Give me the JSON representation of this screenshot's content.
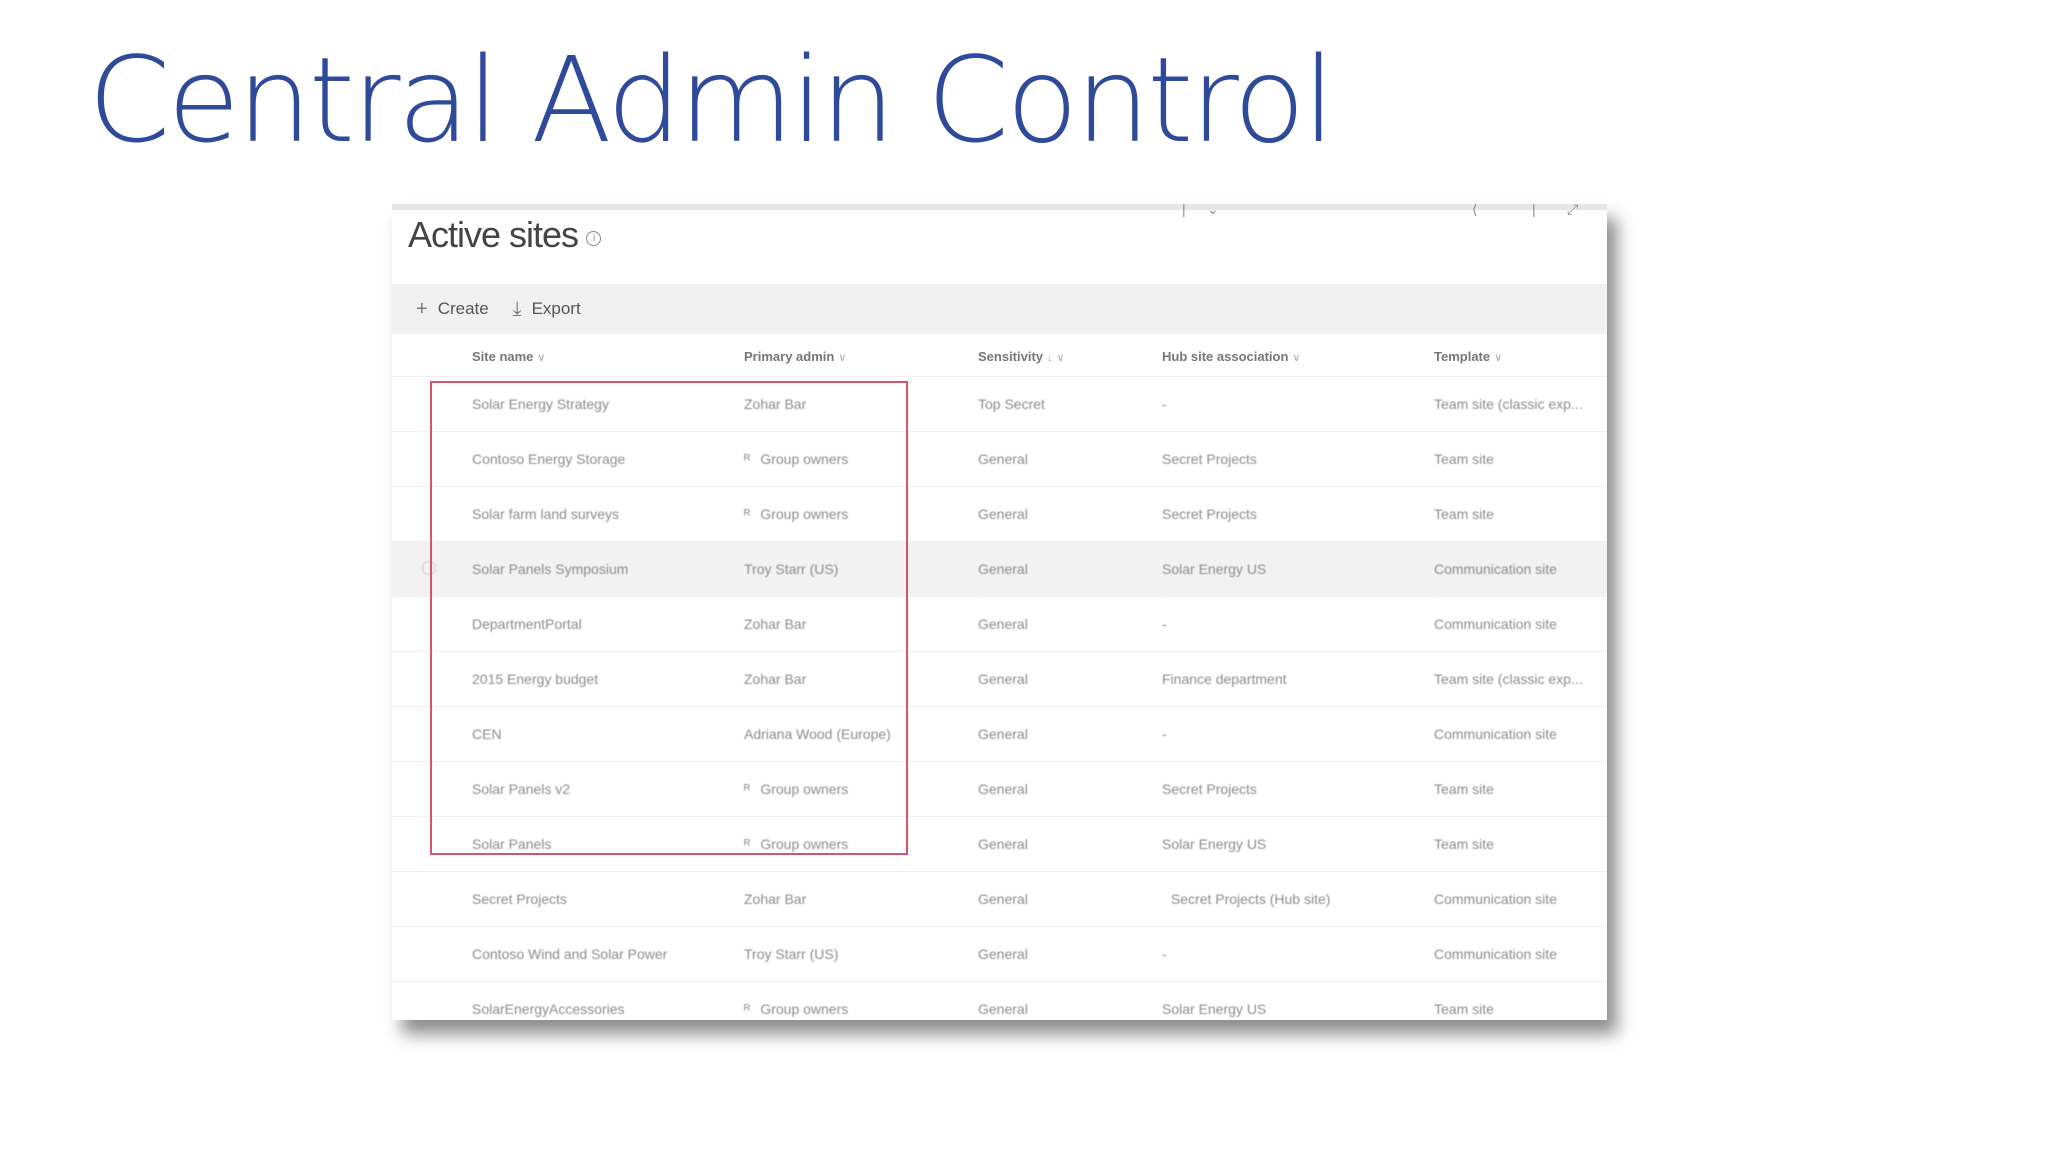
{
  "slide": {
    "title": "Central Admin Control"
  },
  "panel": {
    "title": "Active sites"
  },
  "toolbar": {
    "create_label": "Create",
    "export_label": "Export"
  },
  "table": {
    "columns": [
      {
        "label": "Site name"
      },
      {
        "label": "Primary admin"
      },
      {
        "label": "Sensitivity"
      },
      {
        "label": "Hub site association"
      },
      {
        "label": "Template"
      }
    ],
    "rows": [
      {
        "name": "Solar Energy Strategy",
        "admin": "Zohar Bar",
        "admin_is_group": false,
        "sensitivity": "Top Secret",
        "hub": "-",
        "template": "Team site (classic exp..."
      },
      {
        "name": "Contoso Energy Storage",
        "admin": "Group owners",
        "admin_is_group": true,
        "sensitivity": "General",
        "hub": "Secret Projects",
        "template": "Team site"
      },
      {
        "name": "Solar farm land surveys",
        "admin": "Group owners",
        "admin_is_group": true,
        "sensitivity": "General",
        "hub": "Secret Projects",
        "template": "Team site"
      },
      {
        "name": "Solar Panels Symposium",
        "admin": "Troy Starr (US)",
        "admin_is_group": false,
        "sensitivity": "General",
        "hub": "Solar Energy US",
        "template": "Communication site"
      },
      {
        "name": "DepartmentPortal",
        "admin": "Zohar Bar",
        "admin_is_group": false,
        "sensitivity": "General",
        "hub": "-",
        "template": "Communication site"
      },
      {
        "name": "2015 Energy budget",
        "admin": "Zohar Bar",
        "admin_is_group": false,
        "sensitivity": "General",
        "hub": "Finance department",
        "template": "Team site (classic exp..."
      },
      {
        "name": "CEN",
        "admin": "Adriana Wood (Europe)",
        "admin_is_group": false,
        "sensitivity": "General",
        "hub": "-",
        "template": "Communication site"
      },
      {
        "name": "Solar Panels v2",
        "admin": "Group owners",
        "admin_is_group": true,
        "sensitivity": "General",
        "hub": "Secret Projects",
        "template": "Team site"
      },
      {
        "name": "Solar Panels",
        "admin": "Group owners",
        "admin_is_group": true,
        "sensitivity": "General",
        "hub": "Solar Energy US",
        "template": "Team site"
      },
      {
        "name": "Secret Projects",
        "admin": "Zohar Bar",
        "admin_is_group": false,
        "sensitivity": "General",
        "hub": "Secret Projects (Hub site)",
        "template": "Communication site"
      },
      {
        "name": "Contoso Wind and Solar Power",
        "admin": "Troy Starr (US)",
        "admin_is_group": false,
        "sensitivity": "General",
        "hub": "-",
        "template": "Communication site"
      },
      {
        "name": "SolarEnergyAccessories",
        "admin": "Group owners",
        "admin_is_group": true,
        "sensitivity": "General",
        "hub": "Solar Energy US",
        "template": "Team site"
      }
    ]
  },
  "colors": {
    "title": "#2f4a9a",
    "selection_border": "#d9536a"
  }
}
